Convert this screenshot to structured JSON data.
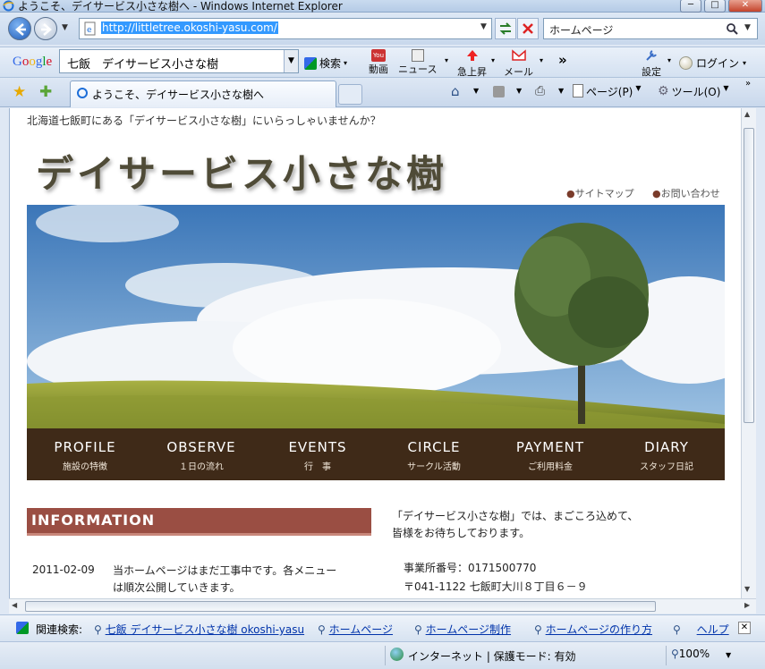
{
  "window": {
    "title": "ようこそ、デイサービス小さな樹へ - Windows Internet Explorer",
    "minimize": "─",
    "maximize": "□",
    "close": "✕"
  },
  "address_bar": {
    "url": "http://littletree.okoshi-yasu.com/",
    "search_placeholder": "ホームページ"
  },
  "google_toolbar": {
    "logo": "Google",
    "query": "七飯　デイサービス小さな樹",
    "search_label": "検索",
    "items": [
      {
        "label": "動画",
        "icon": "youtube-icon"
      },
      {
        "label": "ニュース",
        "icon": "news-icon"
      },
      {
        "label": "急上昇",
        "icon": "trend-arrow-icon"
      },
      {
        "label": "メール",
        "icon": "gmail-icon"
      }
    ],
    "more": "»",
    "settings": "設定",
    "login": "ログイン"
  },
  "tab_bar": {
    "tab_title": "ようこそ、デイサービス小さな樹へ",
    "page_menu": "ページ(P)",
    "tools_menu": "ツール(O)"
  },
  "page": {
    "tagline": "北海道七飯町にある「デイサービス小さな樹」にいらっしゃいませんか？",
    "logo_text": "デイサービス小さな樹",
    "sitemap": "サイトマップ",
    "contact": "お問い合わせ",
    "nav": [
      {
        "en": "PROFILE",
        "jp": "施設の特徴"
      },
      {
        "en": "OBSERVE",
        "jp": "１日の流れ"
      },
      {
        "en": "EVENTS",
        "jp": "行　事"
      },
      {
        "en": "CIRCLE",
        "jp": "サークル活動"
      },
      {
        "en": "PAYMENT",
        "jp": "ご利用料金"
      },
      {
        "en": "DIARY",
        "jp": "スタッフ日記"
      }
    ],
    "info_heading": "INFORMATION",
    "news": [
      {
        "date": "2011-02-09",
        "line1": "当ホームページはまだ工事中です。各メニュー",
        "line2": "は順次公開していきます。"
      }
    ],
    "intro_line1": "「デイサービス小さな樹」では、まごころ込めて、",
    "intro_line2": "皆様をお待ちしております。",
    "office_no": "事業所番号：0171500770",
    "address": "〒041-1122 七飯町大川８丁目６－９"
  },
  "related_bar": {
    "label": "関連検索:",
    "links": [
      "七飯 デイサービス小さな樹 okoshi-yasu",
      "ホームページ",
      "ホームページ制作",
      "ホームページの作り方",
      "ヘルプ"
    ]
  },
  "status_bar": {
    "zone": "インターネット | 保護モード: 有効",
    "zoom": "100%"
  }
}
